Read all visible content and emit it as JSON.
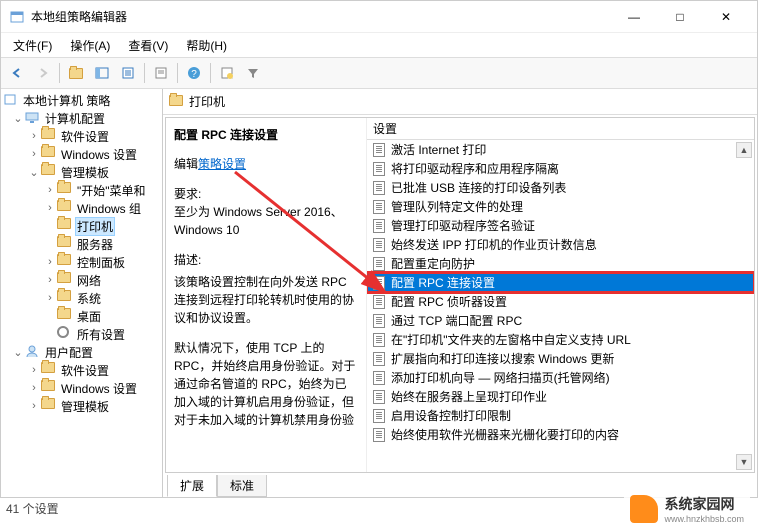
{
  "window": {
    "title": "本地组策略编辑器",
    "min": "—",
    "max": "□",
    "close": "✕"
  },
  "menu": {
    "file": "文件(F)",
    "action": "操作(A)",
    "view": "查看(V)",
    "help": "帮助(H)"
  },
  "tree": {
    "root": "本地计算机 策略",
    "computer_config": "计算机配置",
    "software_settings": "软件设置",
    "windows_settings": "Windows 设置",
    "admin_templates": "管理模板",
    "start_menu": "\"开始\"菜单和",
    "windows_components": "Windows 组",
    "printers": "打印机",
    "server": "服务器",
    "control_panel": "控制面板",
    "network": "网络",
    "system": "系统",
    "desktop": "桌面",
    "all_settings": "所有设置",
    "user_config": "用户配置",
    "u_software": "软件设置",
    "u_windows": "Windows 设置",
    "u_admin": "管理模板"
  },
  "content": {
    "header": "打印机",
    "setting_title": "配置 RPC 连接设置",
    "edit_prefix": "编辑",
    "edit_link": "策略设置",
    "requirements_label": "要求:",
    "requirements_text": "至少为 Windows Server 2016、Windows 10",
    "desc_label": "描述:",
    "desc_p1": "该策略设置控制在向外发送 RPC 连接到远程打印轮转机时使用的协议和协议设置。",
    "desc_p2": "默认情况下，使用 TCP 上的 RPC，并始终启用身份验证。对于通过命名管道的 RPC，始终为已加入域的计算机启用身份验证，但对于未加入域的计算机禁用身份验",
    "list_header": "设置",
    "items": [
      "激活 Internet 打印",
      "将打印驱动程序和应用程序隔离",
      "已批准 USB 连接的打印设备列表",
      "管理队列特定文件的处理",
      "管理打印驱动程序签名验证",
      "始终发送 IPP 打印机的作业页计数信息",
      "配置重定向防护",
      "配置 RPC 连接设置",
      "配置 RPC 侦听器设置",
      "通过 TCP 端口配置 RPC",
      "在\"打印机\"文件夹的左窗格中自定义支持 URL",
      "扩展指向和打印连接以搜索 Windows 更新",
      "添加打印机向导 — 网络扫描页(托管网络)",
      "始终在服务器上呈现打印作业",
      "启用设备控制打印限制",
      "始终使用软件光栅器来光栅化要打印的内容"
    ],
    "selected_index": 7,
    "tabs": {
      "extended": "扩展",
      "standard": "标准"
    }
  },
  "status": "41 个设置",
  "watermark": {
    "brand": "系统家园网",
    "url": "www.hnzkhbsb.com"
  }
}
